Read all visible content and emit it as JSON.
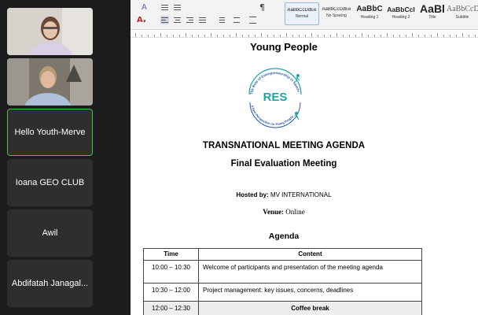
{
  "participants": {
    "tiles": [
      {
        "label": "Hello Youth-Merve",
        "active": true
      },
      {
        "label": "Ioana GEO CLUB",
        "active": false
      },
      {
        "label": "Awil",
        "active": false
      },
      {
        "label": "Abdifatah Janagal..."
      }
    ]
  },
  "ribbon": {
    "styles": [
      {
        "preview": "AaBbCcDdEe",
        "name": "Normal"
      },
      {
        "preview": "AaBbCcDdEe",
        "name": "No Spacing"
      },
      {
        "preview": "AaBbC",
        "name": "Heading 1"
      },
      {
        "preview": "AaBbCcI",
        "name": "Heading 2"
      },
      {
        "preview": "AaBl",
        "name": "Title"
      },
      {
        "preview": "AaBbCcD",
        "name": "Subtitle"
      }
    ],
    "icons": {
      "pilcrow": "¶",
      "font_color": "A",
      "highlight": "A"
    }
  },
  "document": {
    "heading": "Young People",
    "logo_text": "RES",
    "logo_arc_top": "The Role of Entrepreneurship in Sports",
    "logo_arc_bottom": "A New Perspective on Young People",
    "agenda_title": "TRANSNATIONAL MEETING AGENDA",
    "meeting_title": "Final Evaluation Meeting",
    "hosted_label": "Hosted by:",
    "hosted_value": " MV INTERNATIONAL",
    "venue_label": "Venue:",
    "venue_value": " Online",
    "agenda_heading": "Agenda",
    "table": {
      "headers": [
        "Time",
        "Content"
      ],
      "rows": [
        {
          "time": "10:00 – 10:30",
          "content": "Welcome of participants and presentation of the meeting agenda"
        },
        {
          "time": "10:30 – 12:00",
          "content": "Project management: key issues, concerns, deadlines"
        },
        {
          "time": "12:00 – 12:30",
          "content": "Coffee break"
        }
      ]
    }
  },
  "colors": {
    "logo_teal": "#1aa7a5",
    "logo_blue": "#2457a6",
    "active_border": "#4dbf4d"
  }
}
